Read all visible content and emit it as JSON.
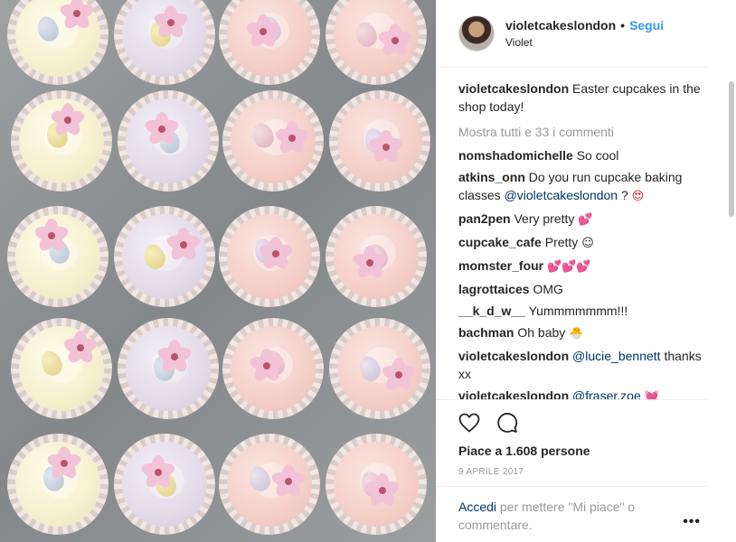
{
  "header": {
    "username": "violetcakeslondon",
    "dot": "•",
    "follow_label": "Segui",
    "full_name": "Violet"
  },
  "caption": {
    "username": "violetcakeslondon",
    "text": "Easter cupcakes in the shop today!"
  },
  "view_all_comments": "Mostra tutti e 33 i commenti",
  "comments": [
    {
      "username": "nomshadomichelle",
      "text": "So cool"
    },
    {
      "username": "atkins_onn",
      "text": "Do you run cupcake baking classes",
      "mention": "@violetcakeslondon",
      "tail": "?",
      "emoji": "😍"
    },
    {
      "username": "pan2pen",
      "text": "Very pretty",
      "emoji": "💕"
    },
    {
      "username": "cupcake_cafe",
      "text": "Pretty",
      "emoji": "☺"
    },
    {
      "username": "momster_four",
      "text": "",
      "emoji": "💕💕💕"
    },
    {
      "username": "lagrottaices",
      "text": "OMG"
    },
    {
      "username": "__k_d_w__",
      "text": "Yummmmmmm!!!"
    },
    {
      "username": "bachman",
      "text": "Oh baby",
      "emoji": "🐣"
    },
    {
      "username": "violetcakeslondon",
      "mention": "@lucie_bennett",
      "text": "thanks xx"
    },
    {
      "username": "violetcakeslondon",
      "mention": "@fraser.zoe",
      "emoji": "💓"
    }
  ],
  "actions": {
    "like_icon": "heart-outline-icon",
    "comment_icon": "speech-bubble-icon",
    "likes_text": "Piace a 1.608 persone",
    "date": "9 APRILE 2017"
  },
  "footer": {
    "login_link": "Accedi",
    "login_suffix": "per mettere \"Mi piace\" o commentare.",
    "more_icon": "ellipsis-icon",
    "more_label": "•••"
  },
  "photo": {
    "alt_subject": "cupcakes"
  }
}
